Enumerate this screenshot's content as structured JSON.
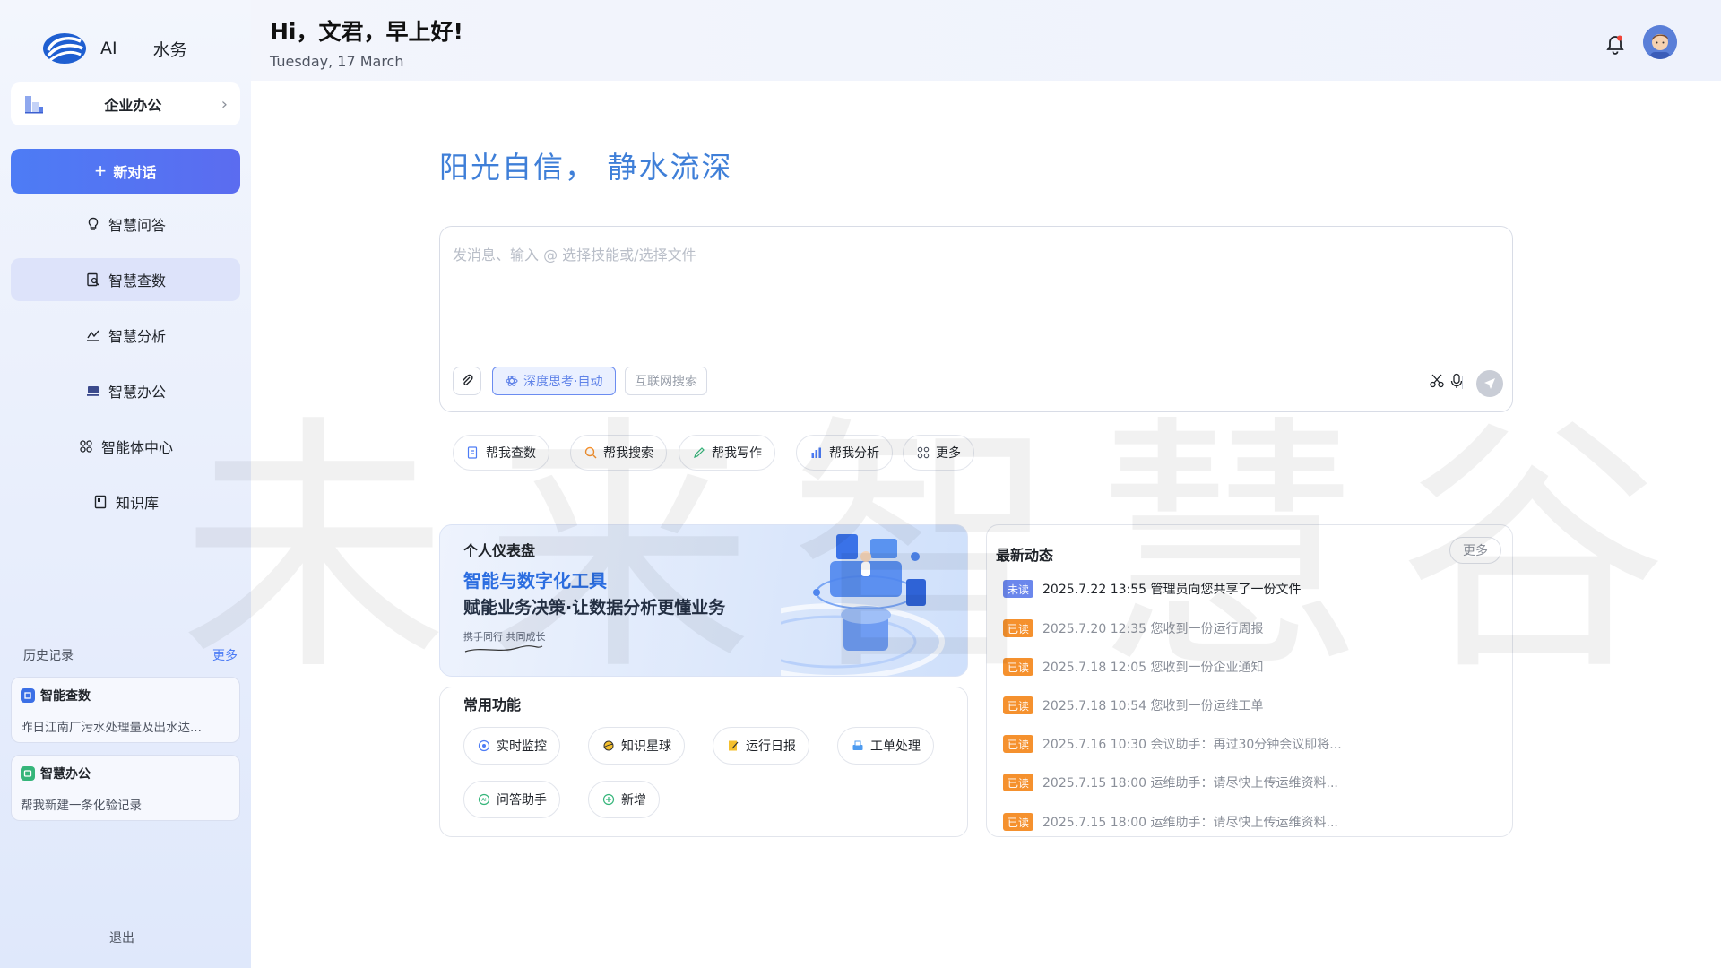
{
  "brand": {
    "ai": "AI",
    "name": "水务"
  },
  "workspace": {
    "label": "企业办公"
  },
  "new_chat": {
    "label": "新对话"
  },
  "nav": [
    {
      "label": "智慧问答",
      "icon": "lightbulb-icon"
    },
    {
      "label": "智慧查数",
      "icon": "data-search-icon",
      "active": true
    },
    {
      "label": "智慧分析",
      "icon": "chart-line-icon"
    },
    {
      "label": "智慧办公",
      "icon": "laptop-icon"
    },
    {
      "label": "智能体中心",
      "icon": "apps-icon"
    },
    {
      "label": "知识库",
      "icon": "book-icon"
    }
  ],
  "history": {
    "title": "历史记录",
    "more": "更多",
    "items": [
      {
        "title": "智能查数",
        "desc": "昨日江南厂污水处理量及出水达...",
        "color": "#3b6fe6"
      },
      {
        "title": "智慧办公",
        "desc": "帮我新建一条化验记录",
        "color": "#35b57a"
      }
    ]
  },
  "logout": "退出",
  "header": {
    "greeting": "Hi，文君，早上好!",
    "date": "Tuesday, 17 March"
  },
  "watermark": "未来智慧谷",
  "slogan": "阳光自信，  静水流深",
  "composer": {
    "placeholder": "发消息、输入 @ 选择技能或/选择文件",
    "deep_think": "深度思考·自动",
    "web_search": "互联网搜索"
  },
  "quick_actions": [
    {
      "label": "帮我查数",
      "icon": "data-query-icon"
    },
    {
      "label": "帮我搜索",
      "icon": "search-icon"
    },
    {
      "label": "帮我写作",
      "icon": "pen-icon"
    },
    {
      "label": "帮我分析",
      "icon": "bar-chart-icon"
    },
    {
      "label": "更多",
      "icon": "grid-icon"
    }
  ],
  "dashboard": {
    "title": "个人仪表盘",
    "headline": "智能与数字化工具",
    "subline": "赋能业务决策·让数据分析更懂业务",
    "tag": "携手同行 共同成长"
  },
  "functions": {
    "title": "常用功能",
    "items": [
      {
        "label": "实时监控",
        "icon": "monitor-icon"
      },
      {
        "label": "知识星球",
        "icon": "planet-icon"
      },
      {
        "label": "运行日报",
        "icon": "report-icon"
      },
      {
        "label": "工单处理",
        "icon": "workorder-icon"
      },
      {
        "label": "问答助手",
        "icon": "ai-assistant-icon"
      },
      {
        "label": "新增",
        "icon": "add-circle-icon"
      }
    ]
  },
  "news": {
    "title": "最新动态",
    "more": "更多",
    "items": [
      {
        "badge": "未读",
        "text": "2025.7.22 13:55 管理员向您共享了一份文件",
        "unread": true
      },
      {
        "badge": "已读",
        "text": "2025.7.20 12:35 您收到一份运行周报",
        "unread": false
      },
      {
        "badge": "已读",
        "text": "2025.7.18 12:05 您收到一份企业通知",
        "unread": false
      },
      {
        "badge": "已读",
        "text": "2025.7.18 10:54 您收到一份运维工单",
        "unread": false
      },
      {
        "badge": "已读",
        "text": "2025.7.16 10:30 会议助手：再过30分钟会议即将...",
        "unread": false
      },
      {
        "badge": "已读",
        "text": "2025.7.15 18:00 运维助手：请尽快上传运维资料...",
        "unread": false
      },
      {
        "badge": "已读",
        "text": "2025.7.15 18:00 运维助手：请尽快上传运维资料...",
        "unread": false
      }
    ]
  },
  "colors": {
    "primary": "#4d7cf5",
    "slogan": "#3f7fd8",
    "unread": "#6b87ec",
    "read": "#f5912e"
  }
}
